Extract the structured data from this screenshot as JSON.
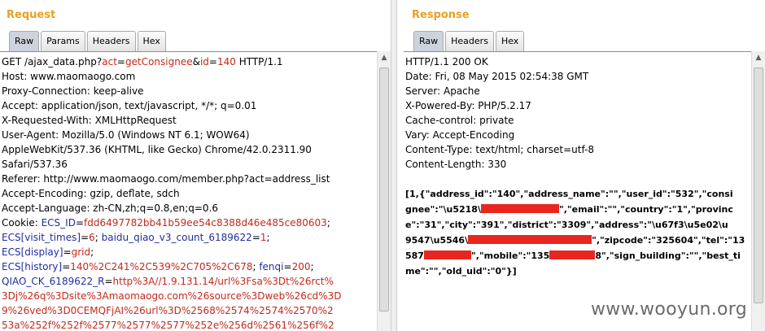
{
  "request": {
    "title": "Request",
    "tabs": [
      "Raw",
      "Params",
      "Headers",
      "Hex"
    ],
    "lines": {
      "l1a": "GET /ajax_data.php?",
      "l1b": "act",
      "l1c": "=",
      "l1d": "getConsignee",
      "l1e": "&",
      "l1f": "id",
      "l1g": "=",
      "l1h": "140",
      "l1i": " HTTP/1.1",
      "l2": "Host: www.maomaogo.com",
      "l3": "Proxy-Connection: keep-alive",
      "l4": "Accept: application/json, text/javascript, */*; q=0.01",
      "l5": "X-Requested-With: XMLHttpRequest",
      "l6": "User-Agent: Mozilla/5.0 (Windows NT 6.1; WOW64)",
      "l7": "AppleWebKit/537.36 (KHTML, like Gecko) Chrome/42.0.2311.90",
      "l8": "Safari/537.36",
      "l9": "Referer: http://www.maomaogo.com/member.php?act=address_list",
      "l10": "Accept-Encoding: gzip, deflate, sdch",
      "l11": "Accept-Language: zh-CN,zh;q=0.8,en;q=0.6",
      "l12a": "Cookie: ",
      "l12b": "ECS_ID",
      "l12c": "=",
      "l12d": "fdd6497782bb41b59ee54c8388d46e485ce80603",
      "l12e": ";",
      "l13a": "ECS[visit_times]",
      "l13b": "=",
      "l13c": "6",
      "l13d": "; ",
      "l13e": "baidu_qiao_v3_count_6189622",
      "l13f": "=",
      "l13g": "1",
      "l13h": ";",
      "l14a": "ECS[display]",
      "l14b": "=",
      "l14c": "grid",
      "l14d": ";",
      "l15a": "ECS[history]",
      "l15b": "=",
      "l15c": "140%2C241%2C539%2C705%2C678",
      "l15d": "; ",
      "l15e": "fenqi",
      "l15f": "=",
      "l15g": "200",
      "l15h": ";",
      "l16a": "QIAO_CK_6189622_R",
      "l16b": "=",
      "l16c": "http%3A//1.9.131.14/url%3Fsa%3Dt%26rct%",
      "l17": "3Dj%26q%3Dsite%3Amaomaogo.com%26source%3Dweb%26cd%3D",
      "l18": "9%26ved%3D0CEMQFjAI%26url%3D%2568%2574%2574%2570%2",
      "l19": "53a%252f%252f%2577%2577%2577%252e%256d%2561%256f%2"
    }
  },
  "response": {
    "title": "Response",
    "tabs": [
      "Raw",
      "Headers",
      "Hex"
    ],
    "headers": {
      "h1": "HTTP/1.1 200 OK",
      "h2": "Date: Fri, 08 May 2015 02:54:38 GMT",
      "h3": "Server: Apache",
      "h4": "X-Powered-By: PHP/5.2.17",
      "h5": "Cache-control: private",
      "h6": "Vary: Accept-Encoding",
      "h7": "Content-Type: text/html; charset=utf-8",
      "h8": "Content-Length: 330"
    },
    "body": {
      "b1": "[1,{\"address_id\":\"140\",\"address_name\":\"\",\"user_id\":\"532\",\"consi",
      "b2a": "gnee\":\"\\u5218\\",
      "b2b": "\",\"email\":\"\",\"country\":\"1\",\"provinc",
      "b3": "e\":\"31\",\"city\":\"391\",\"district\":\"3309\",\"address\":\"\\u67f3\\u5e02\\u",
      "b4a": "9547\\u5546\\",
      "b4b": "\",\"zipcode\":\"325604\",\"tel\":\"13",
      "b5a": "587",
      "b5b": "\",\"mobile\":\"135",
      "b5c": "8\",\"sign_building\":\"\",\"best_ti",
      "b6": "me\":\"\",\"old_uid\":\"0\"}]"
    }
  },
  "watermark": "www.wooyun.org",
  "colors": {
    "accent_title": "#e8a023",
    "param_name": "#1f2fa0",
    "param_value": "#c4291c",
    "redaction": "#e8261f"
  }
}
